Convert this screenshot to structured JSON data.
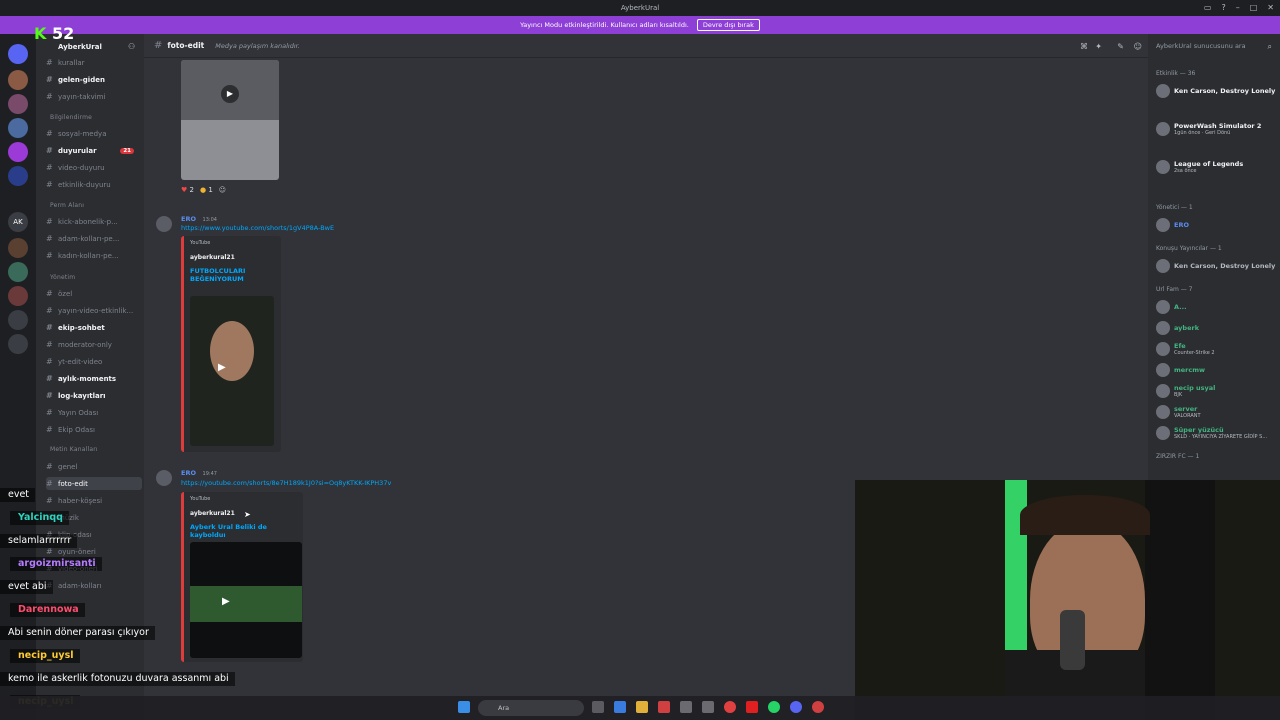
{
  "window": {
    "title": "AyberkUral"
  },
  "banner": {
    "text": "Yayıncı Modu etkinleştirildi. Kullanıcı adları kısaltıldı.",
    "button": "Devre dışı bırak"
  },
  "server": {
    "name": "AyberkUral"
  },
  "channels": {
    "items": [
      {
        "label": "kurallar"
      },
      {
        "label": "gelen-giden"
      },
      {
        "label": "yayın-takvimi"
      },
      {
        "label": "sosyal-medya"
      },
      {
        "label": "duyurular",
        "badge": "21"
      },
      {
        "label": "video-duyuru"
      },
      {
        "label": "etkinlik-duyuru"
      },
      {
        "label": "kick-abonelik-p..."
      },
      {
        "label": "adam-kolları-pe..."
      },
      {
        "label": "kadın-kolları-pe..."
      },
      {
        "label": "özel"
      },
      {
        "label": "yayın-video-etkinlik..."
      },
      {
        "label": "ekip-sohbet"
      },
      {
        "label": "moderator-only"
      },
      {
        "label": "yt-edit-video"
      },
      {
        "label": "aylık-moments"
      },
      {
        "label": "log-kayıtları"
      },
      {
        "label": "Yayın Odası"
      },
      {
        "label": "Ekip Odası"
      },
      {
        "label": "genel"
      },
      {
        "label": "foto-edit"
      },
      {
        "label": "haber-köşesi"
      },
      {
        "label": "müzik"
      },
      {
        "label": "klip-odası"
      },
      {
        "label": "oyun-öneri"
      },
      {
        "label": "video-öneri"
      },
      {
        "label": "adam-kolları"
      }
    ],
    "categories": [
      "Bilgilendirme",
      "Perm Alanı",
      "Yönetim",
      "Metin Kanalları"
    ]
  },
  "chat": {
    "channel": "foto-edit",
    "topic": "Medya paylaşım kanalıdır.",
    "reactions": [
      {
        "emoji": "heart",
        "count": "2"
      },
      {
        "emoji": "coin",
        "count": "1"
      }
    ],
    "messages": [
      {
        "author": "ERO",
        "time": "13:04",
        "url": "https://www.youtube.com/shorts/1gV4P8A-BwE",
        "embed": {
          "provider": "YouTube",
          "author": "ayberkural21",
          "title": "FUTBOLCULARI BEĞENİYORUM"
        }
      },
      {
        "author": "ERO",
        "time": "19:47",
        "url": "https://youtube.com/shorts/8e7H189k1J0?si=Oq8yKTKK-IKPH37v",
        "embed": {
          "provider": "YouTube",
          "author": "ayberkural21",
          "title": "Ayberk Ural Beliki de kaybolduı"
        }
      }
    ]
  },
  "members": {
    "search_placeholder": "AyberkUral sunucusunu ara",
    "groups": [
      {
        "header": "Etkinlik — 36",
        "items": [
          {
            "name": "Ken Carson, Destroy Lonely",
            "status": "",
            "color": "#f2f3f5"
          },
          {
            "name": "PowerWash Simulator 2",
            "status": "1gün önce · Geri Dönü",
            "color": "#f2f3f5"
          },
          {
            "name": "League of Legends",
            "status": "2sa önce",
            "color": "#f2f3f5"
          }
        ]
      },
      {
        "header": "Yönetici — 1",
        "items": [
          {
            "name": "ERO",
            "status": "",
            "color": "#5b8def"
          }
        ]
      },
      {
        "header": "Konuşu Yayıncılar — 1",
        "items": [
          {
            "name": "Ken Carson, Destroy Lonely",
            "status": "",
            "color": "#b5bac1"
          }
        ]
      },
      {
        "header": "Url Fam — 7",
        "items": [
          {
            "name": "A...",
            "status": "",
            "color": "#43b581"
          },
          {
            "name": "ayberk",
            "status": "",
            "color": "#43b581"
          },
          {
            "name": "Efe",
            "status": "Counter-Strike 2",
            "color": "#43b581"
          },
          {
            "name": "mercmw",
            "status": "",
            "color": "#43b581"
          },
          {
            "name": "necip usyal",
            "status": "BJK",
            "color": "#43b581"
          },
          {
            "name": "server",
            "status": "VALORANT",
            "color": "#43b581"
          },
          {
            "name": "Süper yüzücü",
            "status": "SKLD · YAYINCIYA ZİYARETE GİDİP S...",
            "color": "#43b581"
          }
        ]
      },
      {
        "header": "ZIRZIR FC — 1",
        "items": []
      }
    ]
  },
  "stream": {
    "logo": "K",
    "viewers": "52",
    "chat": [
      {
        "text": "evet",
        "kind": "msg"
      },
      {
        "text": "Yalcinqq",
        "kind": "name",
        "color": "#2dd4bf"
      },
      {
        "text": "selamlarrrrrrr",
        "kind": "msg"
      },
      {
        "text": "argoizmirsanti",
        "kind": "name",
        "color": "#b57bff"
      },
      {
        "text": "evet abi",
        "kind": "msg"
      },
      {
        "text": "Darennowa",
        "kind": "name",
        "color": "#ff4d6d"
      },
      {
        "text": "Abi senin döner parası çıkıyor",
        "kind": "msg"
      },
      {
        "text": "necip_uysl",
        "kind": "name",
        "color": "#ffcc33"
      },
      {
        "text": "kemo ile askerlik fotonuzu duvara assanmı abi",
        "kind": "msg"
      },
      {
        "text": "necip_uysl",
        "kind": "name",
        "color": "#ffcc33"
      }
    ]
  },
  "taskbar": {
    "search": "Ara"
  }
}
